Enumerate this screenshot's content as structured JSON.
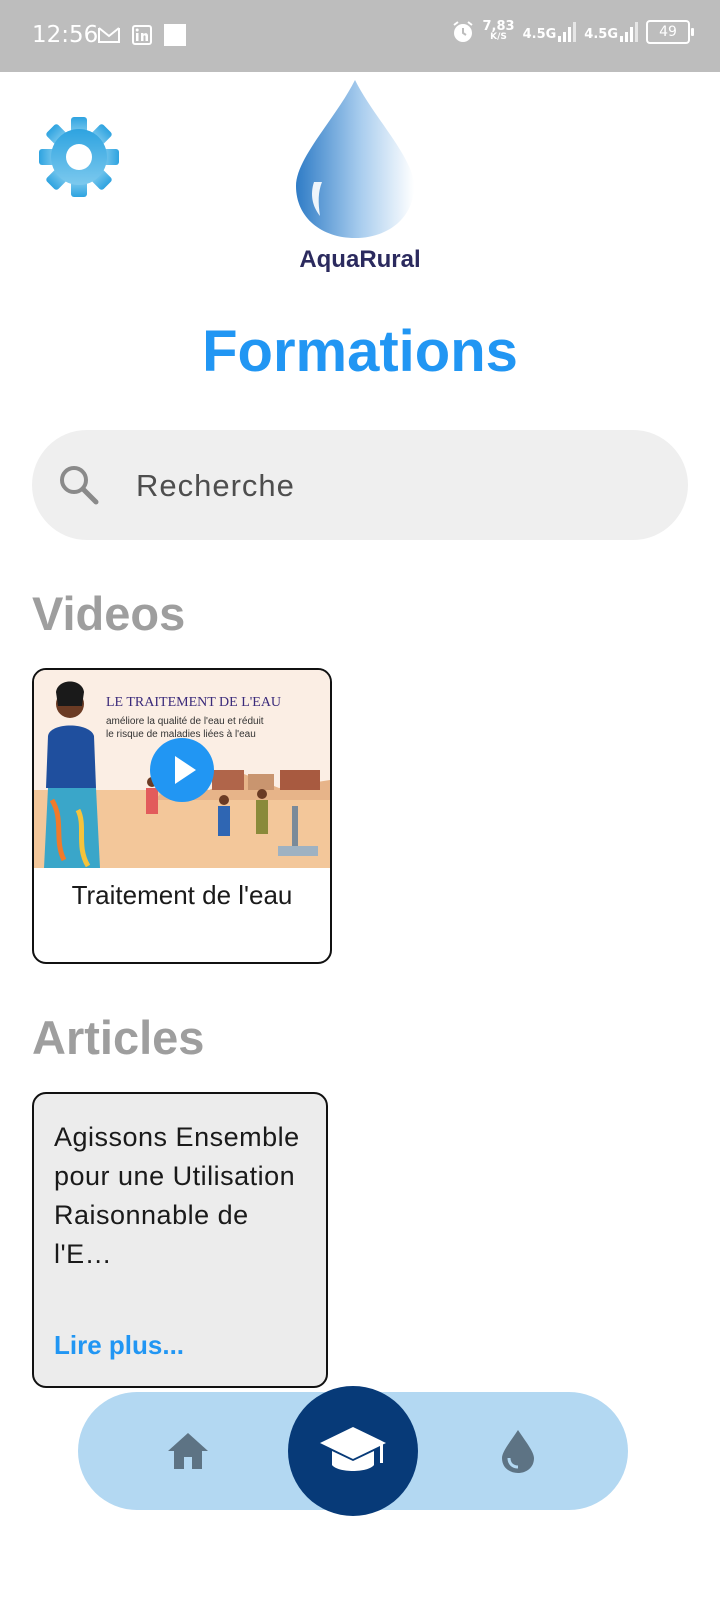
{
  "status_bar": {
    "time": "12:56",
    "net_speed_value": "7,83",
    "net_speed_unit": "K/S",
    "signal_1": "4.5G",
    "signal_2": "4.5G",
    "battery": "49"
  },
  "header": {
    "app_name": "AquaRural",
    "settings_icon": "gear-icon"
  },
  "page": {
    "title": "Formations"
  },
  "search": {
    "placeholder": "Recherche",
    "value": ""
  },
  "videos": {
    "section_title": "Videos",
    "items": [
      {
        "title": "Traitement de l'eau",
        "thumb_heading": "LE TRAITEMENT DE L'EAU",
        "thumb_line1": "améliore la qualité de l'eau et réduit",
        "thumb_line2": "le risque de maladies liées à l'eau"
      }
    ]
  },
  "articles": {
    "section_title": "Articles",
    "items": [
      {
        "title": "Agissons Ensemble pour une Utilisation Raisonnable de l'E…",
        "read_more": "Lire plus..."
      }
    ]
  },
  "colors": {
    "accent": "#2196f3",
    "nav_bg": "#b3d8f2",
    "nav_active": "#073a78",
    "section_title": "#9e9e9e"
  },
  "bottom_nav": {
    "items": [
      "home-icon",
      "graduation-cap-icon",
      "water-drop-icon"
    ],
    "active": "graduation-cap-icon"
  }
}
